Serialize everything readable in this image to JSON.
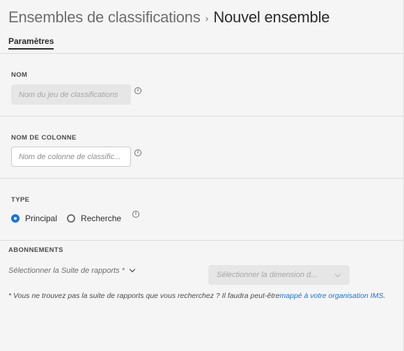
{
  "breadcrumb": {
    "parent": "Ensembles de classifications",
    "separator": "›",
    "current": "Nouvel ensemble"
  },
  "tabs": [
    {
      "label": "Paramètres",
      "active": true
    }
  ],
  "sections": {
    "name": {
      "label": "NOM",
      "placeholder": "Nom du jeu de classifications",
      "disabled": true
    },
    "column_name": {
      "label": "NOM DE COLONNE",
      "placeholder": "Nom de colonne de classific..."
    },
    "type": {
      "label": "TYPE",
      "options": [
        {
          "label": "Principal",
          "checked": true
        },
        {
          "label": "Recherche",
          "checked": false
        }
      ]
    },
    "subscriptions": {
      "label": "ABONNEMENTS",
      "report_suite_placeholder": "Sélectionner la Suite de rapports *",
      "dimension_placeholder": "Sélectionner la dimension d...",
      "note_text": "* Vous ne trouvez pas la suite de rapports que vous recherchez ? Il faudra peut-être",
      "note_link": "mappé à votre organisation IMS",
      "note_end": "."
    }
  },
  "info_glyph": "i",
  "colors": {
    "accent": "#1473e6",
    "background": "#f5f5f5",
    "disabled_field": "#e6e6e6"
  }
}
